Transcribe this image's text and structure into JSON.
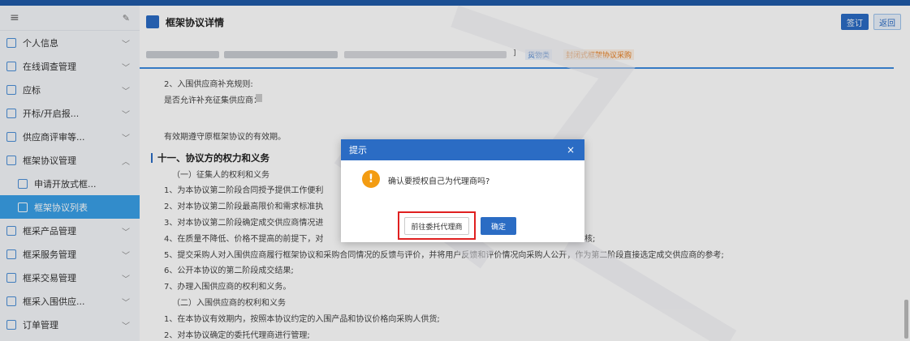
{
  "sidebar": {
    "items": [
      {
        "label": "个人信息",
        "expanded": false
      },
      {
        "label": "在线调查管理",
        "expanded": false
      },
      {
        "label": "应标",
        "expanded": false
      },
      {
        "label": "开标/开启报...",
        "expanded": false
      },
      {
        "label": "供应商评审等...",
        "expanded": false
      },
      {
        "label": "框架协议管理",
        "expanded": true
      },
      {
        "label": "申请开放式框...",
        "sub": true
      },
      {
        "label": "框架协议列表",
        "sub": true,
        "active": true
      },
      {
        "label": "框采产品管理",
        "expanded": false
      },
      {
        "label": "框采服务管理",
        "expanded": false
      },
      {
        "label": "框采交易管理",
        "expanded": false
      },
      {
        "label": "框采入围供应...",
        "expanded": false
      },
      {
        "label": "订单管理",
        "expanded": false
      }
    ]
  },
  "header": {
    "title": "框架协议详情",
    "sign_label": "签订",
    "return_label": "返回"
  },
  "subbar": {
    "bracket": "]",
    "tag1": "货物类",
    "tag2": "封闭式框架协议采购"
  },
  "content": {
    "lines": [
      "2、入围供应商补充规则:",
      "是否允许补充征集供应商：",
      "",
      "有效期遵守原框架协议的有效期。",
      "（一）征集人的权利和义务",
      "1、为本协议第二阶段合同授予提供工作便利",
      "2、对本协议第二阶段最高限价和需求标准执",
      "3、对本协议第二阶段确定成交供应商情况进",
      "4、在质量不降低、价格不提高的前提下，对",
      "5、提交采购人对入围供应商履行框架协议和采购合同情况的反馈与评价，并将用户反馈和评价情况向采购人公开，作为第二阶段直接选定成交供应商的参考;",
      "6、公开本协议的第二阶段成交结果;",
      "7、办理入围供应商的权利和义务。",
      "（二）入围供应商的权利和义务",
      "1、在本协议有效期内，按照本协议约定的入围产品和协议价格向采购人供货;",
      "2、对本协议确定的委托代理商进行管理;"
    ],
    "section_title": "十一、协议方的权力和义务",
    "line4_tail": "核;"
  },
  "dialog": {
    "title": "提示",
    "close": "×",
    "icon": "!",
    "message": "确认要授权自己为代理商吗?",
    "entrust_label": "前往委托代理商",
    "ok_label": "确定"
  },
  "colors": {
    "primary": "#2b6cc4",
    "active": "#3aa0e8",
    "warn": "#f39c12",
    "highlight": "#e02020"
  }
}
